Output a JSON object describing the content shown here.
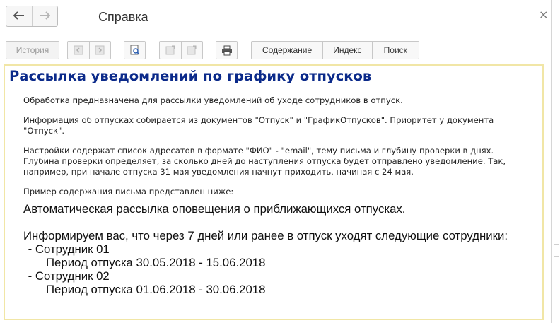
{
  "window": {
    "title": "Справка",
    "close_glyph": "×"
  },
  "nav": {
    "back_glyph": "🡐",
    "forward_glyph": "🡒"
  },
  "toolbar": {
    "history_label": "История",
    "contents_label": "Содержание",
    "index_label": "Индекс",
    "search_label": "Поиск"
  },
  "article": {
    "title": "Рассылка уведомлений по графику отпусков",
    "paragraphs": [
      "Обработка предназначена для рассылки уведомлений об уходе сотрудников в отпуск.",
      "Информация об отпусках собирается из документов \"Отпуск\" и \"ГрафикОтпусков\". Приоритет у документа\n\"Отпуск\".",
      "Настройки содержат список адресатов в формате \"ФИО\" - \"email\", тему письма и глубину проверки в днях.\nГлубина проверки определяет, за сколько дней до наступления отпуска будет отправлено уведомление. Так,\nнапример, при начале отпуска 31 мая уведомления начнут приходить, начиная с 24 мая.",
      "Пример содержания письма представлен ниже:"
    ],
    "sample": {
      "line1": "Автоматическая рассылка оповещения о приближающихся отпусках.",
      "line2": "Информируем вас, что через 7 дней или ранее в отпуск уходят следующие сотрудники:",
      "employee1": " - Сотрудник 01",
      "period1": "Период отпуска 30.05.2018 - 15.06.2018",
      "employee2": " - Сотрудник 02",
      "period2": "Период отпуска 01.06.2018 - 30.06.2018"
    }
  },
  "colors": {
    "heading": "#0b2a8a",
    "frame_border": "#f1e6a6"
  }
}
